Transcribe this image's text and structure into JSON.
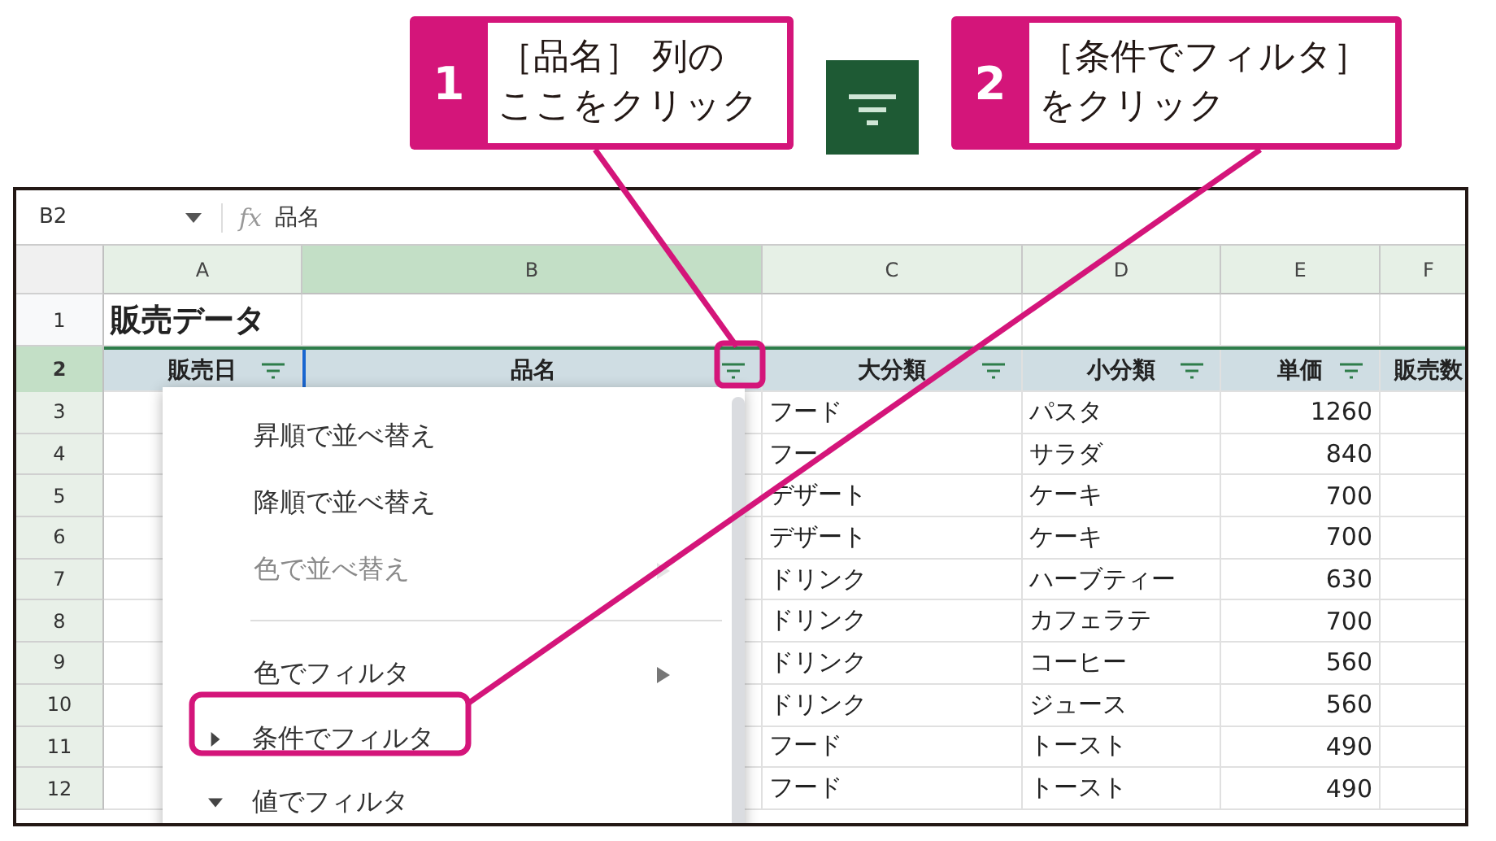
{
  "callouts": [
    {
      "number": "1",
      "lines": [
        "［品名］ 列の",
        "ここをクリック"
      ]
    },
    {
      "number": "2",
      "lines": [
        "［条件でフィルタ］",
        "をクリック"
      ]
    }
  ],
  "formula_bar": {
    "cell_ref": "B2",
    "fx": "fx",
    "formula": "品名"
  },
  "columns": [
    {
      "letter": "A",
      "selected": false
    },
    {
      "letter": "B",
      "selected": true
    },
    {
      "letter": "C",
      "selected": false
    },
    {
      "letter": "D",
      "selected": false
    },
    {
      "letter": "E",
      "selected": false
    },
    {
      "letter": "F",
      "selected": false
    }
  ],
  "title_row": {
    "number": "1",
    "selected": false,
    "title": "販売データ"
  },
  "header_row": {
    "number": "2",
    "selected": true,
    "cells": [
      {
        "text": "販売日",
        "filter": true
      },
      {
        "text": "品名",
        "filter": true
      },
      {
        "text": "大分類",
        "filter": true
      },
      {
        "text": "小分類",
        "filter": true
      },
      {
        "text": "単価",
        "filter": true
      },
      {
        "text": "販売数",
        "filter": false
      }
    ]
  },
  "rows": [
    {
      "number": "3",
      "category": "フード",
      "item": "パスタ",
      "price": "1260"
    },
    {
      "number": "4",
      "category": "フー",
      "item": "サラダ",
      "price": "840"
    },
    {
      "number": "5",
      "category": "デザート",
      "item": "ケーキ",
      "price": "700"
    },
    {
      "number": "6",
      "category": "デザート",
      "item": "ケーキ",
      "price": "700"
    },
    {
      "number": "7",
      "category": "ドリンク",
      "item": "ハーブティー",
      "price": "630"
    },
    {
      "number": "8",
      "category": "ドリンク",
      "item": "カフェラテ",
      "price": "700"
    },
    {
      "number": "9",
      "category": "ドリンク",
      "item": "コーヒー",
      "price": "560"
    },
    {
      "number": "10",
      "category": "ドリンク",
      "item": "ジュース",
      "price": "560"
    },
    {
      "number": "11",
      "category": "フード",
      "item": "トースト",
      "price": "490"
    },
    {
      "number": "12",
      "category": "フード",
      "item": "トースト",
      "price": "490"
    }
  ],
  "filter_menu": [
    {
      "kind": "item",
      "label": "昇順で並べ替え"
    },
    {
      "kind": "item",
      "label": "降順で並べ替え"
    },
    {
      "kind": "submenu",
      "label": "色で並べ替え",
      "disabled": true
    },
    {
      "kind": "divider"
    },
    {
      "kind": "submenu",
      "label": "色でフィルタ",
      "disabled": false
    },
    {
      "kind": "section",
      "label": "条件でフィルタ",
      "expanded": false
    },
    {
      "kind": "section",
      "label": "値でフィルタ",
      "expanded": true
    }
  ]
}
